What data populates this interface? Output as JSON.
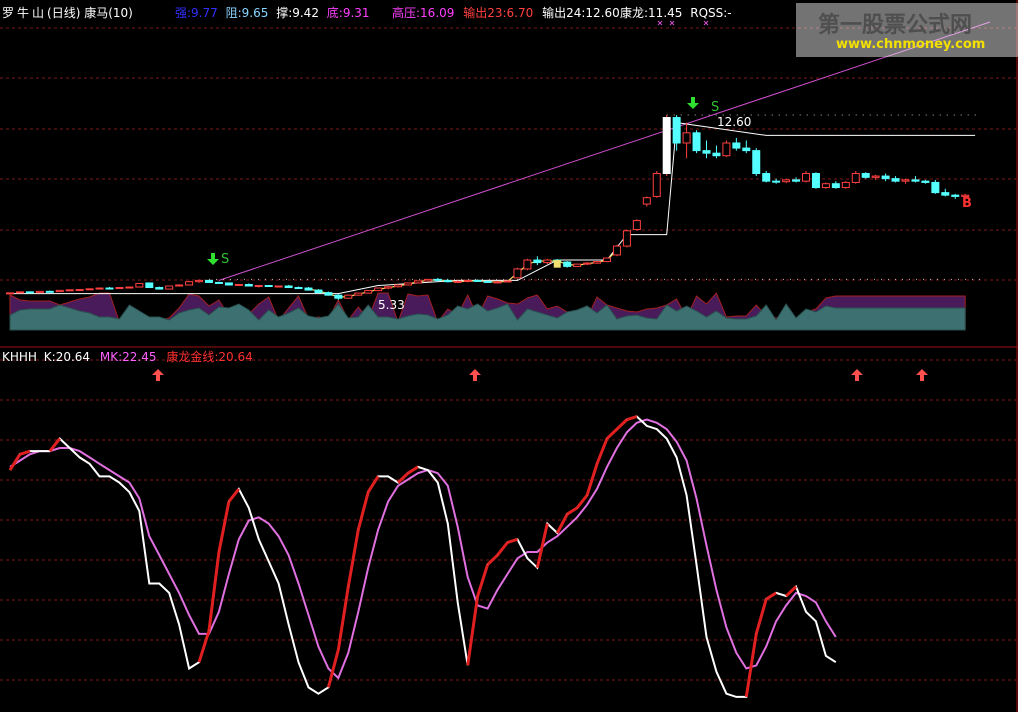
{
  "stock": {
    "name": "罗牛山",
    "period": "(日线)"
  },
  "indicator_top": {
    "name": "康马(10)",
    "items": [
      {
        "label": "强:9.77",
        "color": "#3030ff"
      },
      {
        "label": "阻:9.65",
        "color": "#8ad4ff"
      },
      {
        "label": "撑:9.42",
        "color": "#ffffff"
      },
      {
        "label": "底:9.31",
        "color": "#ff40ff"
      },
      {
        "label": "高压:16.09",
        "color": "#ff40ff"
      },
      {
        "label": "输出23:6.70",
        "color": "#ff4040"
      },
      {
        "label": "输出24:12.60",
        "color": "#ffffff"
      },
      {
        "label": "康龙:11.45",
        "color": "#ffffff"
      },
      {
        "label": "RQSS:-",
        "color": "#ffffff"
      }
    ]
  },
  "indicator_bottom": {
    "items": [
      {
        "label": "KHHH",
        "color": "#ffffff"
      },
      {
        "label": "K:20.64",
        "color": "#ffffff"
      },
      {
        "label": "MK:22.45",
        "color": "#ff60ff"
      },
      {
        "label": "康龙金线:20.64",
        "color": "#ff3030"
      }
    ]
  },
  "annotations": {
    "high_price": "12.60",
    "low_price": "5.33",
    "sell_mark": "S",
    "buy_mark": "B"
  },
  "watermark": {
    "title": "第一股票公式网",
    "url": "www.chnmoney.com"
  },
  "chart_data": [
    {
      "type": "candlestick",
      "title": "罗牛山(日线) 康马(10)",
      "candles": [
        [
          5.6,
          5.62,
          5.58,
          5.61
        ],
        [
          5.61,
          5.66,
          5.6,
          5.65
        ],
        [
          5.65,
          5.67,
          5.6,
          5.62
        ],
        [
          5.62,
          5.68,
          5.62,
          5.67
        ],
        [
          5.67,
          5.7,
          5.64,
          5.66
        ],
        [
          5.66,
          5.72,
          5.65,
          5.71
        ],
        [
          5.71,
          5.74,
          5.7,
          5.73
        ],
        [
          5.73,
          5.76,
          5.72,
          5.74
        ],
        [
          5.74,
          5.78,
          5.73,
          5.77
        ],
        [
          5.77,
          5.82,
          5.76,
          5.8
        ],
        [
          5.8,
          5.84,
          5.78,
          5.79
        ],
        [
          5.79,
          5.83,
          5.78,
          5.82
        ],
        [
          5.82,
          5.86,
          5.8,
          5.84
        ],
        [
          5.84,
          6.0,
          5.83,
          5.98
        ],
        [
          6.0,
          6.02,
          5.8,
          5.82
        ],
        [
          5.82,
          5.86,
          5.74,
          5.76
        ],
        [
          5.76,
          5.9,
          5.75,
          5.88
        ],
        [
          5.88,
          5.95,
          5.86,
          5.92
        ],
        [
          5.92,
          6.08,
          5.9,
          6.05
        ],
        [
          6.05,
          6.14,
          6.0,
          6.1
        ],
        [
          6.1,
          6.12,
          6.0,
          6.02
        ],
        [
          6.02,
          6.05,
          5.98,
          6.0
        ],
        [
          6.0,
          6.02,
          5.9,
          5.92
        ],
        [
          5.92,
          5.96,
          5.9,
          5.94
        ],
        [
          5.94,
          5.98,
          5.86,
          5.88
        ],
        [
          5.88,
          5.92,
          5.82,
          5.9
        ],
        [
          5.9,
          5.92,
          5.85,
          5.86
        ],
        [
          5.86,
          5.9,
          5.82,
          5.88
        ],
        [
          5.88,
          5.92,
          5.8,
          5.82
        ],
        [
          5.82,
          5.86,
          5.78,
          5.8
        ],
        [
          5.8,
          5.84,
          5.7,
          5.72
        ],
        [
          5.72,
          5.76,
          5.6,
          5.62
        ],
        [
          5.62,
          5.66,
          5.5,
          5.52
        ],
        [
          5.52,
          5.56,
          5.33,
          5.4
        ],
        [
          5.4,
          5.55,
          5.38,
          5.52
        ],
        [
          5.52,
          5.62,
          5.5,
          5.6
        ],
        [
          5.6,
          5.72,
          5.58,
          5.7
        ],
        [
          5.7,
          5.82,
          5.68,
          5.8
        ],
        [
          5.8,
          5.88,
          5.75,
          5.85
        ],
        [
          5.85,
          5.95,
          5.82,
          5.92
        ],
        [
          5.92,
          6.02,
          5.9,
          6.0
        ],
        [
          6.0,
          6.1,
          5.98,
          6.08
        ],
        [
          6.08,
          6.16,
          6.05,
          6.14
        ],
        [
          6.14,
          6.2,
          6.05,
          6.1
        ],
        [
          6.1,
          6.15,
          6.02,
          6.05
        ],
        [
          6.05,
          6.1,
          6.0,
          6.06
        ],
        [
          6.06,
          6.12,
          6.02,
          6.1
        ],
        [
          6.1,
          6.14,
          6.04,
          6.06
        ],
        [
          6.06,
          6.1,
          6.0,
          6.02
        ],
        [
          6.02,
          6.08,
          6.0,
          6.04
        ],
        [
          6.04,
          6.1,
          6.02,
          6.08
        ],
        [
          6.2,
          6.6,
          6.18,
          6.55
        ],
        [
          6.55,
          6.95,
          6.5,
          6.9
        ],
        [
          6.9,
          7.05,
          6.7,
          6.8
        ],
        [
          6.8,
          6.95,
          6.74,
          6.9
        ],
        [
          6.9,
          6.94,
          6.8,
          6.82
        ],
        [
          6.82,
          6.86,
          6.6,
          6.65
        ],
        [
          6.65,
          6.76,
          6.62,
          6.74
        ],
        [
          6.74,
          6.82,
          6.7,
          6.78
        ],
        [
          6.78,
          6.86,
          6.75,
          6.84
        ],
        [
          6.84,
          7.0,
          6.82,
          6.98
        ],
        [
          7.1,
          7.5,
          7.05,
          7.45
        ],
        [
          7.45,
          8.1,
          7.4,
          8.05
        ],
        [
          8.1,
          8.5,
          8.05,
          8.45
        ],
        [
          9.1,
          9.4,
          9.0,
          9.35
        ],
        [
          9.4,
          10.4,
          9.35,
          10.3
        ],
        [
          10.3,
          12.6,
          10.2,
          12.5
        ],
        [
          12.5,
          12.6,
          11.2,
          11.5
        ],
        [
          11.5,
          12.3,
          10.9,
          11.9
        ],
        [
          11.9,
          12.0,
          11.1,
          11.2
        ],
        [
          11.2,
          11.6,
          10.9,
          11.1
        ],
        [
          11.1,
          11.4,
          10.9,
          11.0
        ],
        [
          11.0,
          11.6,
          10.95,
          11.5
        ],
        [
          11.5,
          11.7,
          11.2,
          11.3
        ],
        [
          11.3,
          11.6,
          11.1,
          11.2
        ],
        [
          11.2,
          11.3,
          10.2,
          10.3
        ],
        [
          10.3,
          10.4,
          9.95,
          10.0
        ],
        [
          10.0,
          10.1,
          9.9,
          9.98
        ],
        [
          9.98,
          10.1,
          9.92,
          10.05
        ],
        [
          10.05,
          10.15,
          9.95,
          10.0
        ],
        [
          10.0,
          10.4,
          9.95,
          10.3
        ],
        [
          10.3,
          10.35,
          9.7,
          9.75
        ],
        [
          9.75,
          9.95,
          9.7,
          9.9
        ],
        [
          9.9,
          10.0,
          9.7,
          9.75
        ],
        [
          9.75,
          10.0,
          9.7,
          9.95
        ],
        [
          9.95,
          10.4,
          9.9,
          10.3
        ],
        [
          10.3,
          10.35,
          10.1,
          10.15
        ],
        [
          10.15,
          10.25,
          10.05,
          10.2
        ],
        [
          10.2,
          10.3,
          10.0,
          10.1
        ],
        [
          10.1,
          10.2,
          9.95,
          10.0
        ],
        [
          10.0,
          10.1,
          9.9,
          10.05
        ],
        [
          10.05,
          10.2,
          9.95,
          10.0
        ],
        [
          10.0,
          10.05,
          9.9,
          9.95
        ],
        [
          9.95,
          10.05,
          9.5,
          9.55
        ],
        [
          9.55,
          9.7,
          9.4,
          9.45
        ],
        [
          9.45,
          9.5,
          9.3,
          9.4
        ],
        [
          9.4,
          9.5,
          9.3,
          9.45
        ]
      ]
    },
    {
      "type": "line",
      "title": "KHHH",
      "series": [
        {
          "name": "K",
          "values": [
            73,
            78,
            79,
            79,
            79,
            83,
            80,
            77,
            75,
            71,
            71,
            69,
            66,
            60,
            37,
            37,
            34,
            24,
            10,
            12,
            22,
            47,
            63,
            67,
            61,
            51,
            44,
            37,
            24,
            12,
            4,
            2,
            4,
            16,
            36,
            54,
            66,
            71,
            71,
            69,
            72,
            74,
            73,
            69,
            56,
            31,
            11,
            33,
            43,
            46,
            50,
            51,
            45,
            42,
            56,
            53,
            59,
            61,
            65,
            75,
            83,
            86,
            89,
            90,
            87,
            86,
            83,
            77,
            65,
            43,
            20,
            9,
            2,
            1,
            1,
            21,
            32,
            34,
            33,
            36,
            28,
            25,
            14,
            12
          ]
        },
        {
          "name": "MK",
          "values": [
            74,
            76,
            78,
            79,
            79,
            80,
            80,
            79,
            77,
            75,
            73,
            71,
            69,
            64,
            52,
            46,
            40,
            34,
            27,
            21,
            21,
            28,
            40,
            51,
            57,
            58,
            56,
            52,
            46,
            37,
            27,
            17,
            10,
            7,
            15,
            28,
            42,
            54,
            63,
            68,
            70,
            72,
            73,
            72,
            68,
            55,
            39,
            30,
            29,
            35,
            40,
            45,
            47,
            47,
            50,
            52,
            55,
            58,
            62,
            67,
            74,
            80,
            85,
            88,
            89,
            88,
            86,
            82,
            76,
            64,
            49,
            35,
            23,
            15,
            10,
            11,
            17,
            25,
            30,
            34,
            33,
            31,
            25,
            20
          ]
        },
        {
          "name": "康龙金线",
          "values": [
            73,
            78,
            79,
            79,
            79,
            83,
            80,
            77,
            75,
            71,
            71,
            69,
            66,
            60,
            37,
            37,
            34,
            24,
            10,
            12,
            22,
            47,
            63,
            67,
            61,
            51,
            44,
            37,
            24,
            12,
            4,
            2,
            4,
            16,
            36,
            54,
            66,
            71,
            71,
            69,
            72,
            74,
            73,
            69,
            56,
            31,
            11,
            33,
            43,
            46,
            50,
            51,
            45,
            42,
            56,
            53,
            59,
            61,
            65,
            75,
            83,
            86,
            89,
            90,
            87,
            86,
            83,
            77,
            65,
            43,
            20,
            9,
            2,
            1,
            1,
            21,
            32,
            34,
            33,
            36,
            28,
            25,
            14,
            12
          ]
        }
      ],
      "ylim": [
        0,
        100
      ]
    }
  ]
}
